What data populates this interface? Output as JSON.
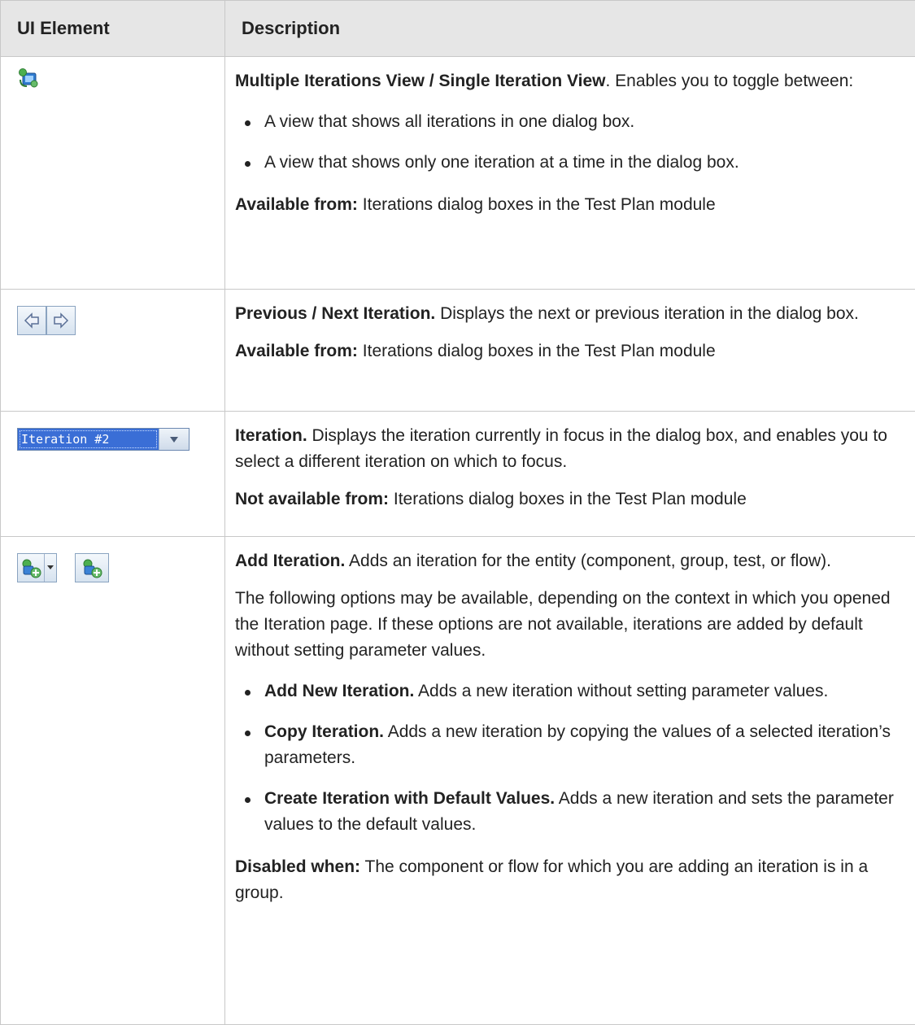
{
  "header": {
    "col1": "UI Element",
    "col2": "Description"
  },
  "rows": [
    {
      "icon": "multiple-single-iteration-view-icon",
      "title": "Multiple Iterations View / Single Iteration View",
      "text": ". Enables you to toggle between:",
      "bullets": [
        "A view that shows all iterations in one dialog box.",
        "A view that shows only one iteration at a time in the dialog box."
      ],
      "note_label": "Available from:",
      "note_text": " Iterations dialog boxes in the Test Plan module"
    },
    {
      "icon": "previous-next-iteration-icons",
      "title": "Previous / Next Iteration.",
      "text": " Displays the next or previous iteration in the dialog box.",
      "note_label": "Available from:",
      "note_text": " Iterations dialog boxes in the Test Plan module"
    },
    {
      "icon": "iteration-dropdown",
      "dropdown_value": "Iteration #2",
      "title": "Iteration.",
      "text": " Displays the iteration currently in focus in the dialog box, and enables you to select a different iteration on which to focus.",
      "note_label": "Not available from:",
      "note_text": " Iterations dialog boxes in the Test Plan module"
    },
    {
      "icon": "add-iteration-icons",
      "title": "Add Iteration.",
      "text": " Adds an iteration for the entity (component, group, test, or flow).",
      "para": "The following options may be available, depending on the context in which you opened the Iteration page. If these options are not available, iterations are added by default without setting parameter values.",
      "bullets": [
        {
          "label": "Add New Iteration.",
          "text": " Adds a new iteration without setting parameter values."
        },
        {
          "label": "Copy Iteration.",
          "text": " Adds a new iteration by copying the values of a selected iteration’s parameters."
        },
        {
          "label": "Create Iteration with Default Values.",
          "text": " Adds a new iteration and sets the parameter values to the default values."
        }
      ],
      "note_label": "Disabled when:",
      "note_text": " The component or flow for which you are adding an iteration is in a group."
    }
  ]
}
